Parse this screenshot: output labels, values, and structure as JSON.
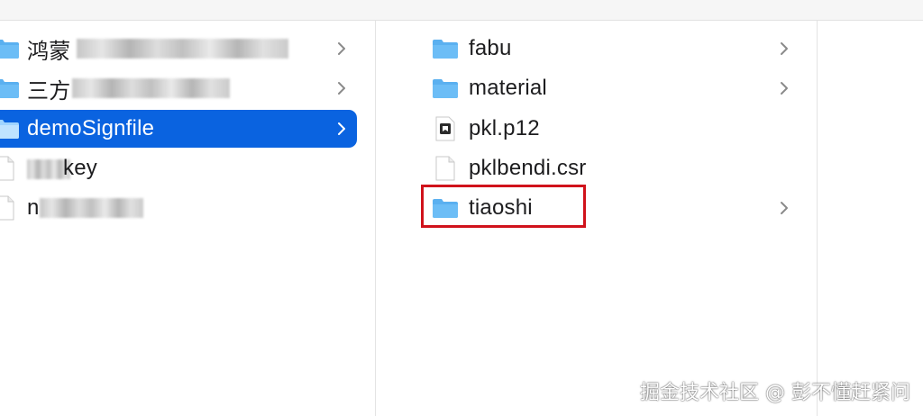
{
  "finder": {
    "left_column": {
      "items": [
        {
          "label": "鸿蒙",
          "kind": "folder",
          "has_chevron": true,
          "selected": false
        },
        {
          "label": "三方",
          "kind": "folder",
          "has_chevron": true,
          "selected": false
        },
        {
          "label": "demoSignfile",
          "kind": "folder",
          "has_chevron": true,
          "selected": true
        },
        {
          "label": "key",
          "kind": "file",
          "has_chevron": false,
          "selected": false
        },
        {
          "label": "n",
          "kind": "file",
          "has_chevron": false,
          "selected": false
        }
      ]
    },
    "right_column": {
      "items": [
        {
          "label": "fabu",
          "kind": "folder",
          "has_chevron": true
        },
        {
          "label": "material",
          "kind": "folder",
          "has_chevron": true
        },
        {
          "label": "pkl.p12",
          "kind": "certificate-file",
          "has_chevron": false
        },
        {
          "label": "pklbendi.csr",
          "kind": "file",
          "has_chevron": false
        },
        {
          "label": "tiaoshi",
          "kind": "folder",
          "has_chevron": true,
          "highlighted": true
        }
      ]
    }
  },
  "highlight_color": "#d0121b",
  "selection_color": "#0a63e0",
  "watermark": "掘金技术社区 @ 彭不懂赶紧问"
}
